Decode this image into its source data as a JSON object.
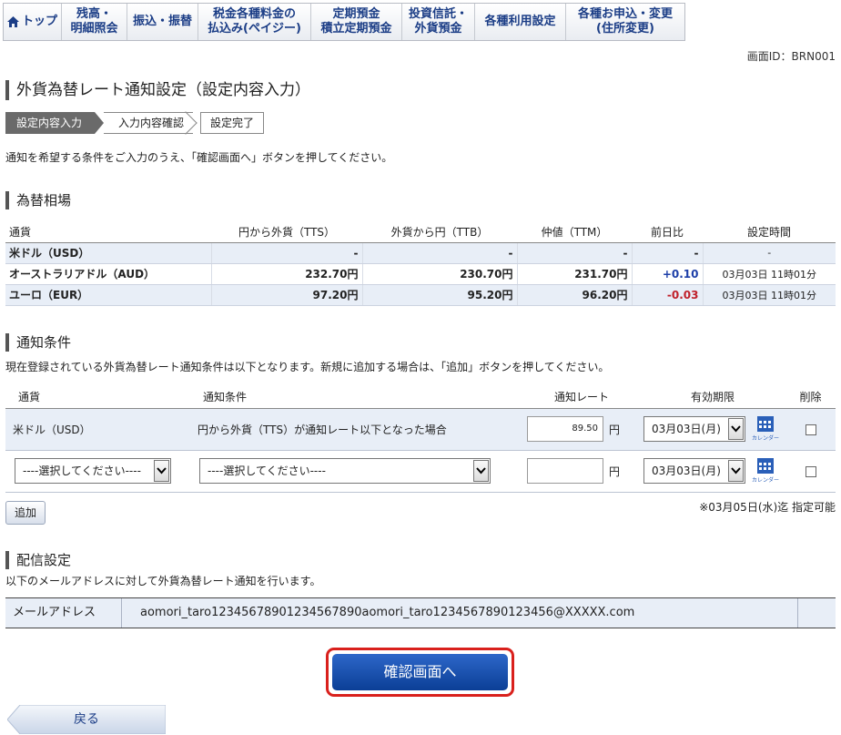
{
  "nav": {
    "items": [
      {
        "label": "トップ"
      },
      {
        "line1": "残高・",
        "line2": "明細照会"
      },
      {
        "label": "振込・振替"
      },
      {
        "line1": "税金各種料金の",
        "line2": "払込み(ペイジー)"
      },
      {
        "line1": "定期預金",
        "line2": "積立定期預金"
      },
      {
        "line1": "投資信託・",
        "line2": "外貨預金"
      },
      {
        "label": "各種利用設定"
      },
      {
        "line1": "各種お申込・変更",
        "line2": "(住所変更)"
      }
    ]
  },
  "screen_id": "画面ID：BRN001",
  "page_title": "外貨為替レート通知設定（設定内容入力）",
  "steps": [
    "設定内容入力",
    "入力内容確認",
    "設定完了"
  ],
  "intro": "通知を希望する条件をご入力のうえ、「確認画面へ」ボタンを押してください。",
  "rates": {
    "section_title": "為替相場",
    "headers": [
      "通貨",
      "円から外貨（TTS）",
      "外貨から円（TTB）",
      "仲値（TTM）",
      "前日比",
      "設定時間"
    ],
    "rows": [
      {
        "currency": "米ドル（USD）",
        "tts": "-",
        "ttb": "-",
        "ttm": "-",
        "change": "-",
        "time": "-"
      },
      {
        "currency": "オーストラリアドル（AUD）",
        "tts": "232.70円",
        "ttb": "230.70円",
        "ttm": "231.70円",
        "change": "+0.10",
        "time": "03月03日  11時01分"
      },
      {
        "currency": "ユーロ（EUR）",
        "tts": "97.20円",
        "ttb": "95.20円",
        "ttm": "96.20円",
        "change": "-0.03",
        "time": "03月03日  11時01分"
      }
    ]
  },
  "conditions": {
    "section_title": "通知条件",
    "description": "現在登録されている外貨為替レート通知条件は以下となります。新規に追加する場合は、「追加」ボタンを押してください。",
    "headers": [
      "通貨",
      "通知条件",
      "通知レート",
      "有効期限",
      "削除"
    ],
    "rows": [
      {
        "currency": "米ドル（USD）",
        "condition": "円から外貨（TTS）が通知レート以下となった場合",
        "rate": "89.50",
        "yen": "円",
        "expiry": "03月03日(月)"
      },
      {
        "currency_select": "----選択してください----",
        "condition_select": "----選択してください----",
        "rate": "",
        "yen": "円",
        "expiry": "03月03日(月)"
      }
    ],
    "calendar_label": "カレンダー",
    "add_label": "追加",
    "limit_note": "※03月05日(水)迄 指定可能"
  },
  "delivery": {
    "section_title": "配信設定",
    "description": "以下のメールアドレスに対して外貨為替レート通知を行います。",
    "mail_label": "メールアドレス",
    "mail_value": "aomori_taro12345678901234567890aomori_taro1234567890123456@XXXXX.com"
  },
  "confirm_label": "確認画面へ",
  "back_label": "戻る",
  "colors": {
    "nav_text": "#1b3d86",
    "positive": "#1d3fa8",
    "negative": "#c0202a",
    "confirm_border": "#d9201c"
  }
}
